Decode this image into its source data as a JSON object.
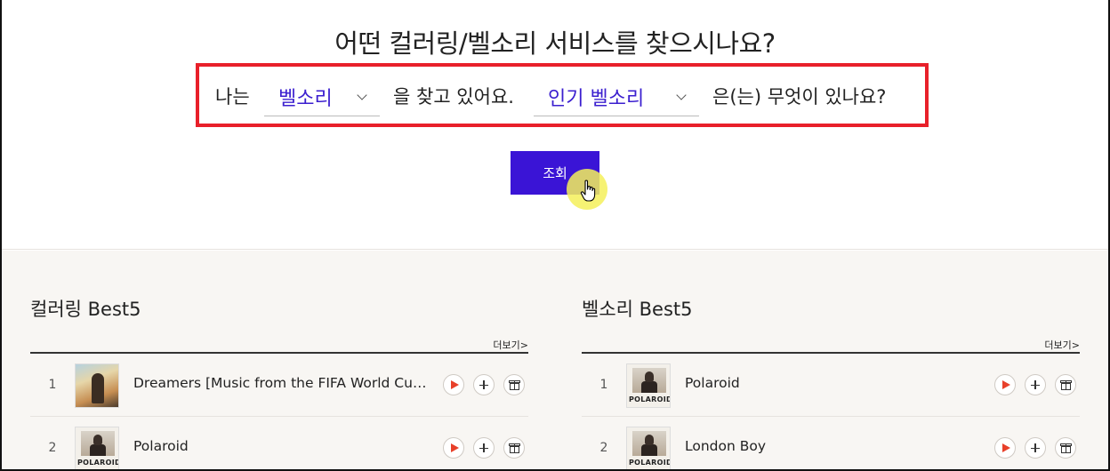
{
  "finder": {
    "question": "어떤 컬러링/벨소리 서비스를 찾으시나요?",
    "prefix": "나는",
    "type_select": "벨소리",
    "middle": "을 찾고 있어요.",
    "category_select": "인기 벨소리",
    "suffix": "은(는) 무엇이 있나요?",
    "search_label": "조회",
    "highlight_color": "#e8202a",
    "accent_color": "#3a14d6"
  },
  "coloring": {
    "title": "컬러링 Best5",
    "more": "더보기>",
    "items": [
      {
        "rank": "1",
        "title": "Dreamers [Music from the FIFA World Cup ...",
        "art": "dreamers"
      },
      {
        "rank": "2",
        "title": "Polaroid",
        "art": "polaroid",
        "art_text": "POLAROID"
      }
    ]
  },
  "bell": {
    "title": "벨소리 Best5",
    "more": "더보기>",
    "items": [
      {
        "rank": "1",
        "title": "Polaroid",
        "art": "polaroid",
        "art_text": "POLAROID"
      },
      {
        "rank": "2",
        "title": "London Boy",
        "art": "polaroid",
        "art_text": "POLAROID"
      }
    ]
  },
  "icons": [
    "play-icon",
    "add-icon",
    "gift-icon",
    "chevron-down-icon",
    "hand-cursor-icon"
  ]
}
